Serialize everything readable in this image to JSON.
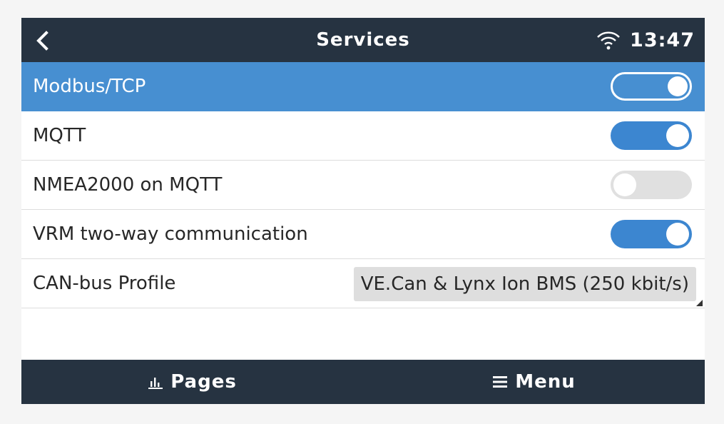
{
  "header": {
    "back_icon": "chevron-left-icon",
    "title": "Services",
    "wifi_icon": "wifi-icon",
    "time": "13:47"
  },
  "services": [
    {
      "label": "Modbus/TCP",
      "control": "toggle",
      "on": true,
      "selected": true
    },
    {
      "label": "MQTT",
      "control": "toggle",
      "on": true,
      "selected": false
    },
    {
      "label": "NMEA2000 on MQTT",
      "control": "toggle",
      "on": false,
      "selected": false
    },
    {
      "label": "VRM two-way communication",
      "control": "toggle",
      "on": true,
      "selected": false
    },
    {
      "label": "CAN-bus Profile",
      "control": "dropdown",
      "value": "VE.Can & Lynx Ion BMS (250 kbit/s)",
      "selected": false
    }
  ],
  "footer": {
    "pages_icon": "bar-chart-icon",
    "pages_label": "Pages",
    "menu_icon": "hamburger-icon",
    "menu_label": "Menu"
  },
  "colors": {
    "bar_background": "#263341",
    "selected_row": "#478fd1",
    "toggle_on": "#3c86d0",
    "toggle_off": "#e0e0e0",
    "dropdown_background": "#dedede"
  }
}
